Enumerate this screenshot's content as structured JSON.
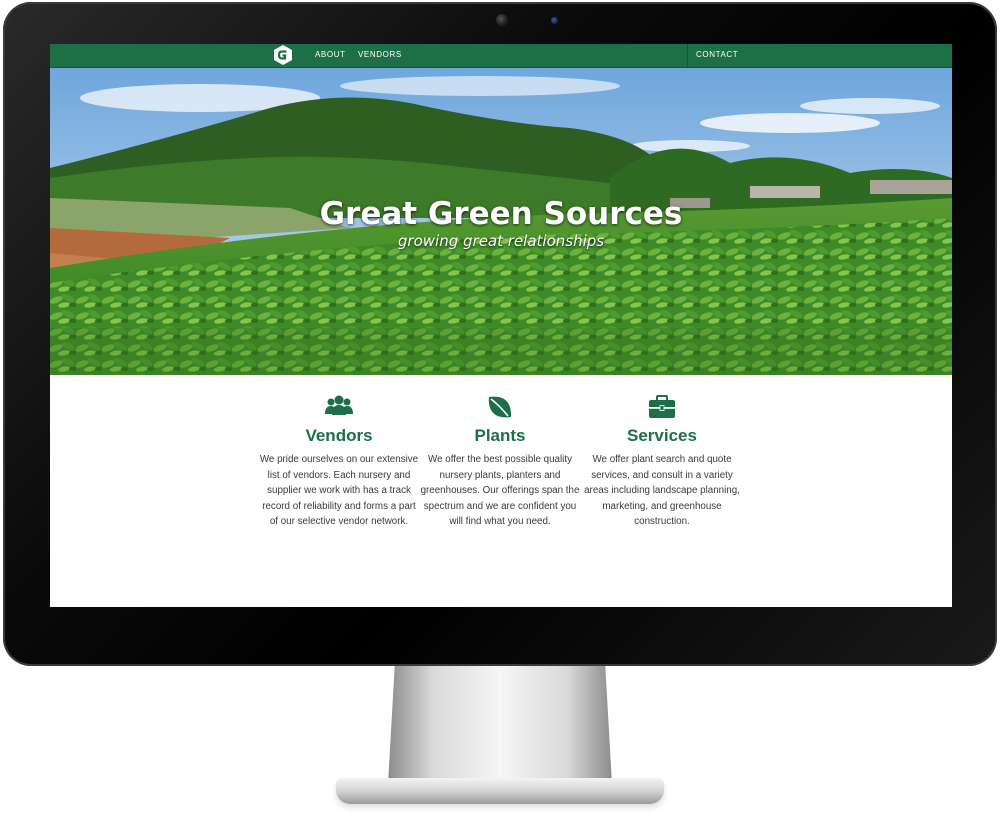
{
  "nav": {
    "about": "ABOUT",
    "vendors": "VENDORS",
    "contact": "CONTACT"
  },
  "hero": {
    "title": "Great Green Sources",
    "subtitle": "growing great relationships"
  },
  "features": [
    {
      "title": "Vendors",
      "icon": "people-icon",
      "text": "We pride ourselves on our extensive list of vendors. Each nursery and supplier we work with has a track record of reliability and forms a part of our selective vendor network."
    },
    {
      "title": "Plants",
      "icon": "leaf-icon",
      "text": "We offer the best possible quality nursery plants, planters and greenhouses. Our offerings span the spectrum and we are confident you will find what you need."
    },
    {
      "title": "Services",
      "icon": "briefcase-icon",
      "text": "We offer plant search and quote services, and consult in a variety areas including landscape planning, marketing, and greenhouse construction."
    }
  ],
  "colors": {
    "brand_green": "#1d7046",
    "bezel": "#000000"
  }
}
